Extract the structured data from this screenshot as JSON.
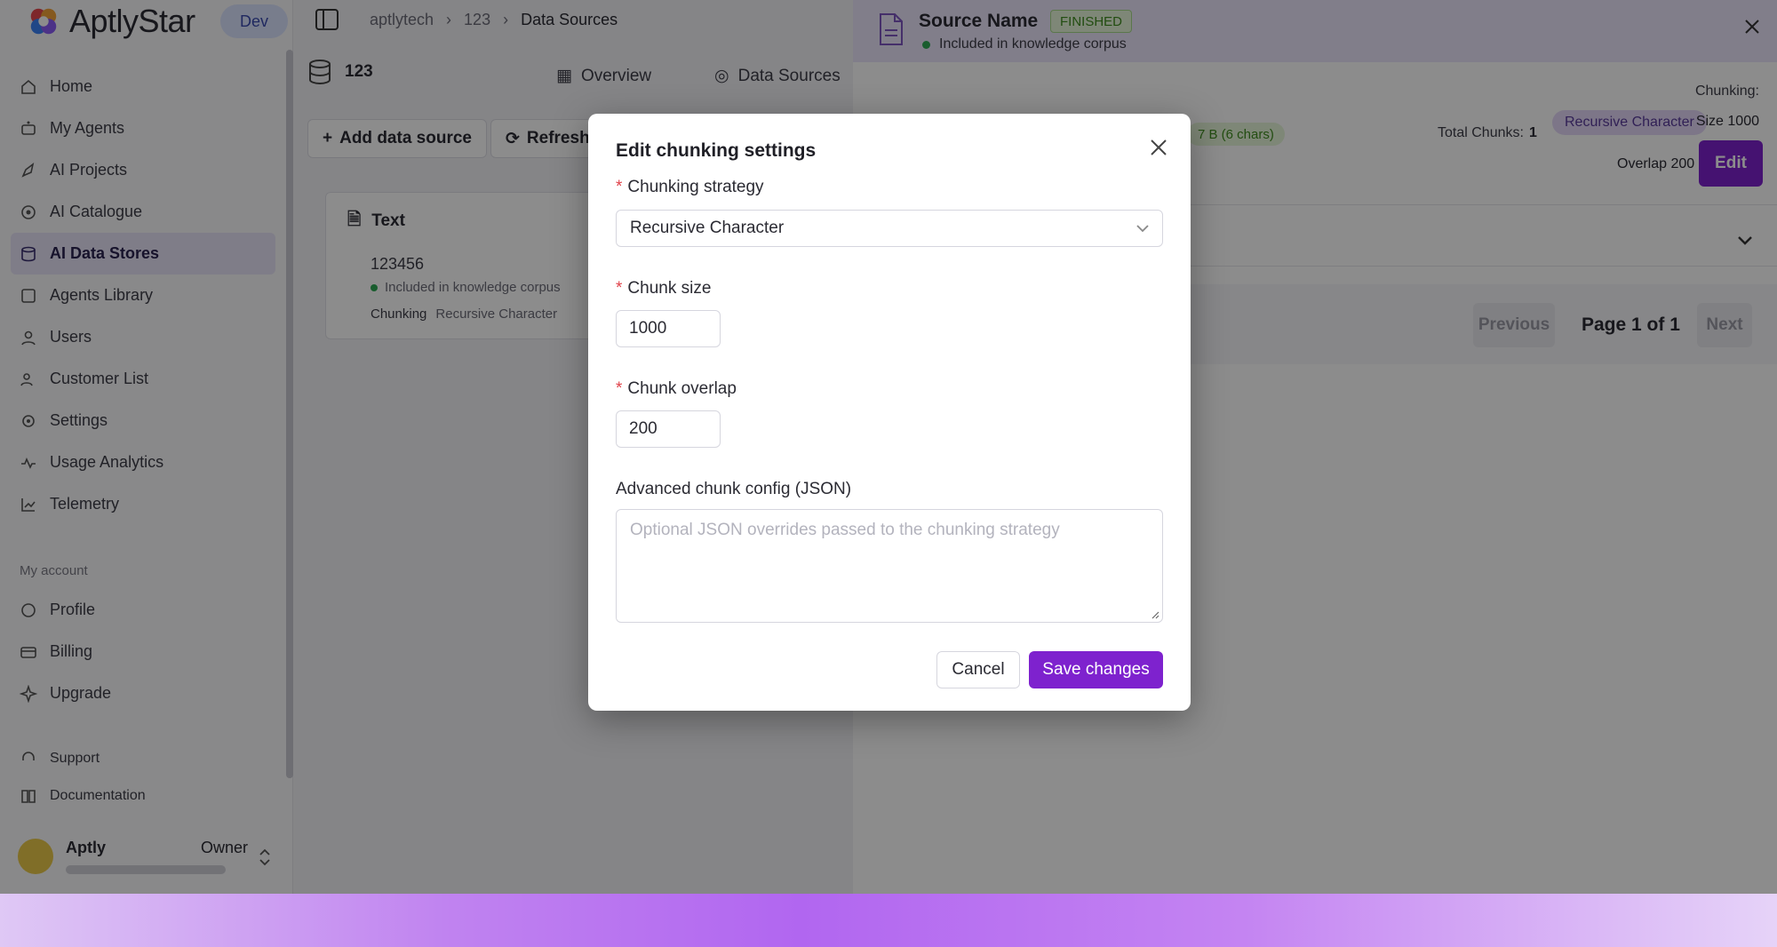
{
  "app": {
    "brand": "AptlyStar",
    "env": "Dev",
    "breadcrumbs": [
      "aptlytech",
      "123",
      "Data Sources"
    ],
    "nav": [
      "Home",
      "My Agents",
      "AI Projects",
      "AI Catalogue",
      "AI Data Stores",
      "Agents Library",
      "Users",
      "Customer List",
      "Settings",
      "Usage Analytics",
      "Telemetry"
    ],
    "nav_active": "AI Data Stores",
    "account_section": "My account",
    "account": [
      "Profile",
      "Billing",
      "Upgrade"
    ],
    "help": [
      "Support",
      "Documentation"
    ],
    "user": {
      "name": "Aptly",
      "role": "Owner"
    },
    "datastore": {
      "name": "123",
      "tabs": [
        "Overview",
        "Data Sources"
      ],
      "add_label": "Add data source",
      "refresh_label": "Refresh",
      "list_header": "Text",
      "item_name": "123456",
      "item_status": "Included in knowledge corpus",
      "item_chunking_label": "Chunking",
      "item_chunking_value": "Recursive Character"
    }
  },
  "drawer": {
    "source_name": "Source Name",
    "status_badge": "FINISHED",
    "corpus_status": "Included in knowledge corpus",
    "chunking_label": "Chunking:",
    "size_info": "7 B (6 chars)",
    "total_chunks_label": "Total Chunks:",
    "total_chunks_value": "1",
    "strategy_pill": "Recursive Character",
    "size_text": "Size 1000",
    "overlap_text": "Overlap 200",
    "edit_label": "Edit",
    "pager": {
      "previous": "Previous",
      "page_text": "Page 1 of 1",
      "next": "Next"
    }
  },
  "modal": {
    "title": "Edit chunking settings",
    "strategy_label": "Chunking strategy",
    "strategy_value": "Recursive Character",
    "size_label": "Chunk size",
    "size_value": "1000",
    "overlap_label": "Chunk overlap",
    "overlap_value": "200",
    "advanced_label": "Advanced chunk config (JSON)",
    "advanced_placeholder": "Optional JSON overrides passed to the chunking strategy",
    "cancel_label": "Cancel",
    "save_label": "Save changes"
  },
  "colors": {
    "accent": "#7e22ce",
    "success": "#2faa55",
    "required": "#e0434b"
  }
}
